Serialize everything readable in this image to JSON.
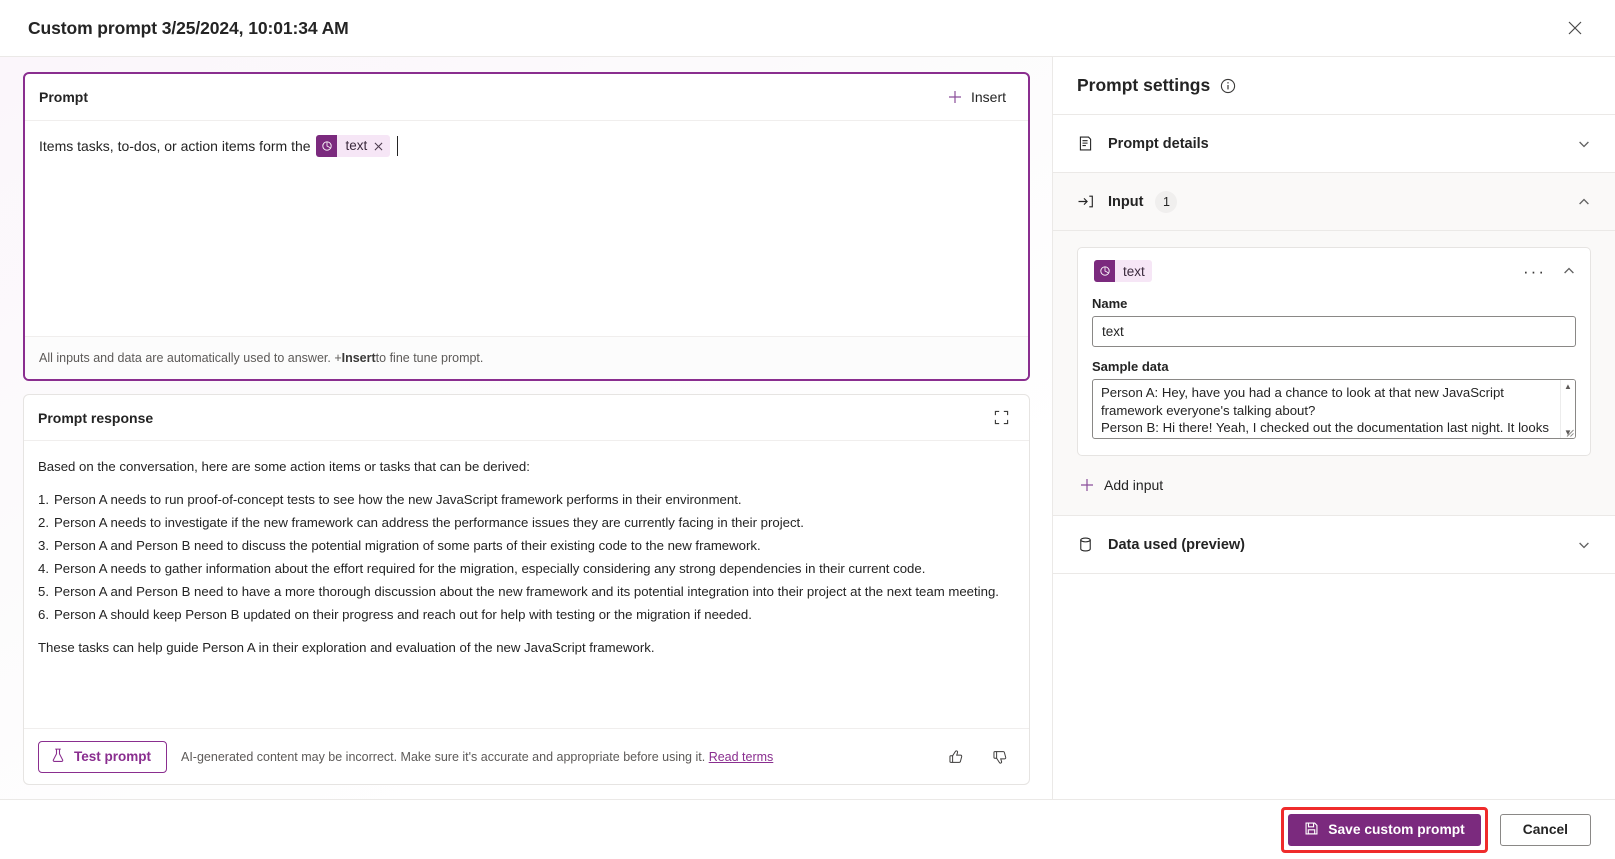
{
  "window": {
    "title": "Custom prompt 3/25/2024, 10:01:34 AM",
    "close_label": "Close"
  },
  "prompt_card": {
    "header_label": "Prompt",
    "insert_label": "Insert",
    "text_before_token": "Items tasks, to-dos, or action items form the ",
    "token_label": "text",
    "footer_text_start": "All inputs and data are automatically used to answer. + ",
    "footer_text_bold": "Insert",
    "footer_text_end": " to fine tune prompt."
  },
  "response_card": {
    "header_label": "Prompt response",
    "intro": "Based on the conversation, here are some action items or tasks that can be derived:",
    "items": [
      {
        "num": "1.",
        "text": "Person A needs to run proof-of-concept tests to see how the new JavaScript framework performs in their environment."
      },
      {
        "num": "2.",
        "text": "Person A needs to investigate if the new framework can address the performance issues they are currently facing in their project."
      },
      {
        "num": "3.",
        "text": "Person A and Person B need to discuss the potential migration of some parts of their existing code to the new framework."
      },
      {
        "num": "4.",
        "text": "Person A needs to gather information about the effort required for the migration, especially considering any strong dependencies in their current code."
      },
      {
        "num": "5.",
        "text": "Person A and Person B need to have a more thorough discussion about the new framework and its potential integration into their project at the next team meeting."
      },
      {
        "num": "6.",
        "text": "Person A should keep Person B updated on their progress and reach out for help with testing or the migration if needed."
      }
    ],
    "outro": "These tasks can help guide Person A in their exploration and evaluation of the new JavaScript framework.",
    "test_button_label": "Test prompt",
    "disclaimer_text": "AI-generated content may be incorrect. Make sure it's accurate and appropriate before using it. ",
    "disclaimer_link": "Read terms"
  },
  "settings_panel": {
    "title": "Prompt settings",
    "sections": [
      {
        "label": "Prompt details",
        "expanded": false
      },
      {
        "label": "Input",
        "count": "1",
        "expanded": true
      },
      {
        "label": "Data used (preview)",
        "expanded": false
      }
    ],
    "input_card": {
      "token_label": "text",
      "name_label": "Name",
      "name_value": "text",
      "sample_label": "Sample data",
      "sample_value": "Person A: Hey, have you had a chance to look at that new JavaScript framework everyone's talking about?\nPerson B: Hi there! Yeah, I checked out the documentation last night. It looks promising. Performance-wise, it might be the shot"
    },
    "add_input_label": "Add input"
  },
  "footer": {
    "save_label": "Save custom prompt",
    "cancel_label": "Cancel"
  },
  "colors": {
    "brand_purple": "#7b2a7e",
    "accent_purple": "#8a2e8f",
    "highlight_red": "#ef2b2b"
  }
}
